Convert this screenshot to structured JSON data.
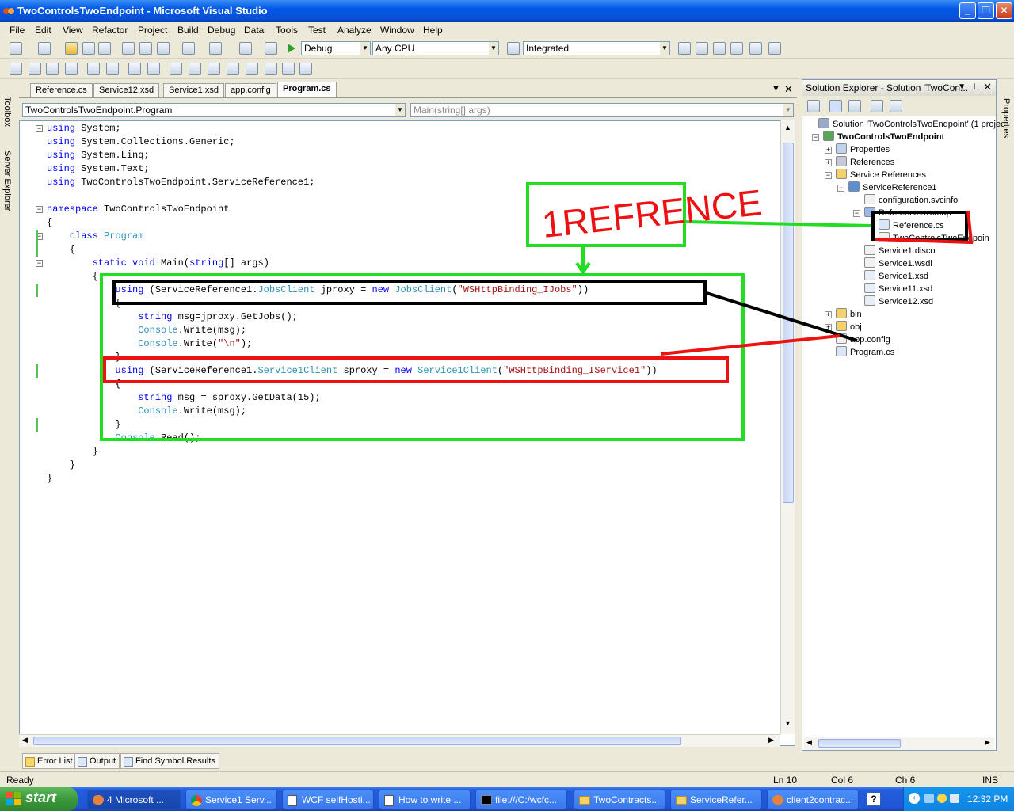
{
  "window": {
    "title": "TwoControlsTwoEndpoint - Microsoft Visual Studio"
  },
  "menu": [
    "File",
    "Edit",
    "View",
    "Refactor",
    "Project",
    "Build",
    "Debug",
    "Data",
    "Tools",
    "Test",
    "Analyze",
    "Window",
    "Help"
  ],
  "toolbar": {
    "config": "Debug",
    "platform": "Any CPU",
    "find": "Integrated"
  },
  "left_strip": {
    "toolbox": "Toolbox",
    "server_explorer": "Server Explorer"
  },
  "right_strip": {
    "properties": "Properties"
  },
  "doc_tabs": [
    "Reference.cs",
    "Service12.xsd",
    "Service1.xsd",
    "app.config",
    "Program.cs"
  ],
  "nav": {
    "type": "TwoControlsTwoEndpoint.Program",
    "member": "Main(string[] args)"
  },
  "code": [
    "using System;",
    "using System.Collections.Generic;",
    "using System.Linq;",
    "using System.Text;",
    "using TwoControlsTwoEndpoint.ServiceReference1;",
    "",
    "namespace TwoControlsTwoEndpoint",
    "{",
    "    class Program",
    "    {",
    "        static void Main(string[] args)",
    "        {",
    "            using (ServiceReference1.JobsClient jproxy = new JobsClient(\"WSHttpBinding_IJobs\"))",
    "            {",
    "                string msg=jproxy.GetJobs();",
    "                Console.Write(msg);",
    "                Console.Write(\"\\n\");",
    "            }",
    "            using (ServiceReference1.Service1Client sproxy = new Service1Client(\"WSHttpBinding_IService1\"))",
    "            {",
    "                string msg = sproxy.GetData(15);",
    "                Console.Write(msg);",
    "            }",
    "            Console.Read();",
    "        }",
    "    }",
    "}"
  ],
  "bottom_tabs": [
    "Error List",
    "Output",
    "Find Symbol Results"
  ],
  "solution_explorer": {
    "title": "Solution Explorer - Solution 'TwoCon...",
    "nodes": [
      {
        "label": "Solution 'TwoControlsTwoEndpoint' (1 projec"
      },
      {
        "label": "TwoControlsTwoEndpoint"
      },
      {
        "label": "Properties"
      },
      {
        "label": "References"
      },
      {
        "label": "Service References"
      },
      {
        "label": "ServiceReference1"
      },
      {
        "label": "configuration.svcinfo"
      },
      {
        "label": "Reference.svcmap"
      },
      {
        "label": "Reference.cs"
      },
      {
        "label": "TwoControlsTwoEndpoin"
      },
      {
        "label": "Service1.disco"
      },
      {
        "label": "Service1.wsdl"
      },
      {
        "label": "Service1.xsd"
      },
      {
        "label": "Service11.xsd"
      },
      {
        "label": "Service12.xsd"
      },
      {
        "label": "bin"
      },
      {
        "label": "obj"
      },
      {
        "label": "app.config"
      },
      {
        "label": "Program.cs"
      }
    ]
  },
  "annotation": {
    "text": "1REFRENCE",
    "green": "#22dd22",
    "red": "#ee1111",
    "black": "#000000"
  },
  "status": {
    "ready": "Ready",
    "ln": "Ln 10",
    "col": "Col 6",
    "ch": "Ch 6",
    "ins": "INS"
  },
  "taskbar": {
    "start": "start",
    "items": [
      "4 Microsoft ...",
      "Service1 Serv...",
      "WCF selfHosti...",
      "How to write ...",
      "file:///C:/wcfc...",
      "TwoContracts...",
      "ServiceRefer...",
      "client2contrac..."
    ],
    "clock": "12:32 PM"
  },
  "colors": {
    "keyword": "#0000ff",
    "type": "#2b91af",
    "string": "#a31515"
  }
}
